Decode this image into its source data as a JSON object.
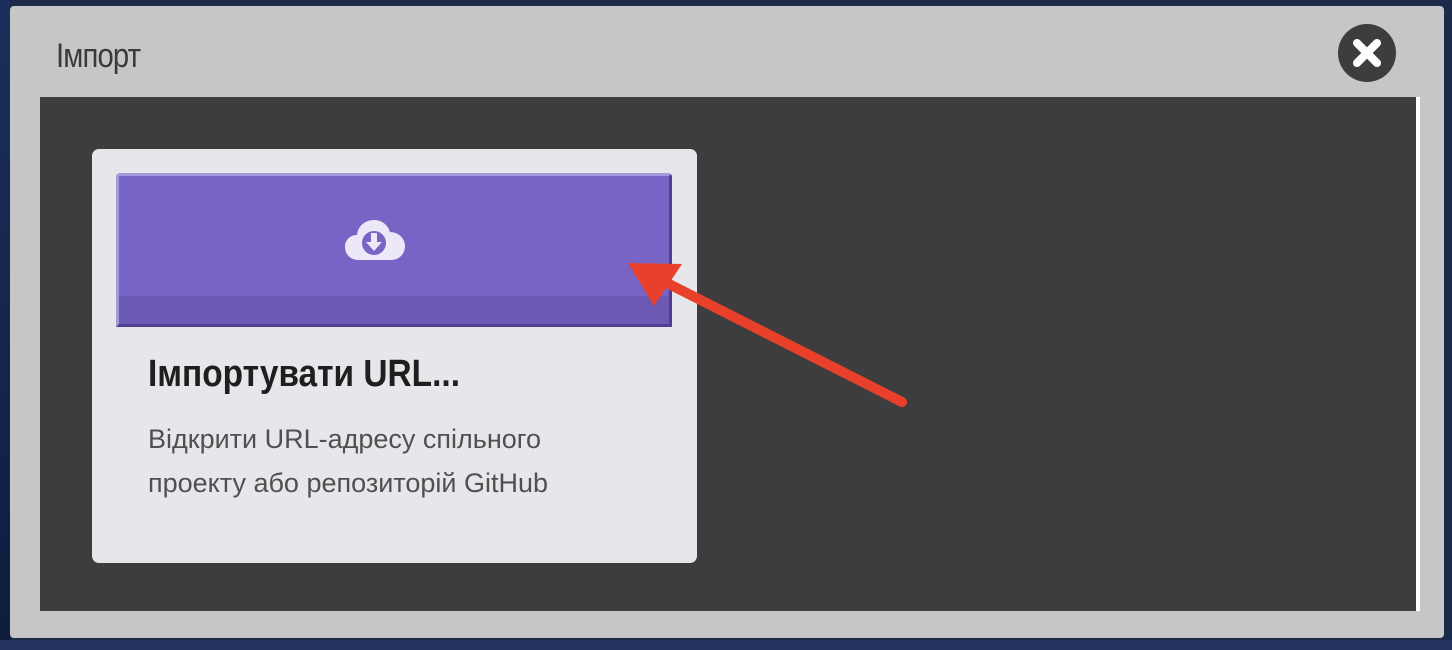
{
  "dialog": {
    "title": "Імпорт",
    "close_icon": "close-icon"
  },
  "import_option": {
    "icon": "cloud-download-icon",
    "title": "Імпортувати URL...",
    "description_line1": "Відкрити URL-адресу спільного",
    "description_line2": "проекту або репозиторій GitHub"
  },
  "colors": {
    "dialog_background": "#c6c6c6",
    "body_background": "#3d3d3d",
    "card_background": "#e6e7ea",
    "banner_purple": "#7764c4",
    "arrow_red": "#e8402a"
  }
}
